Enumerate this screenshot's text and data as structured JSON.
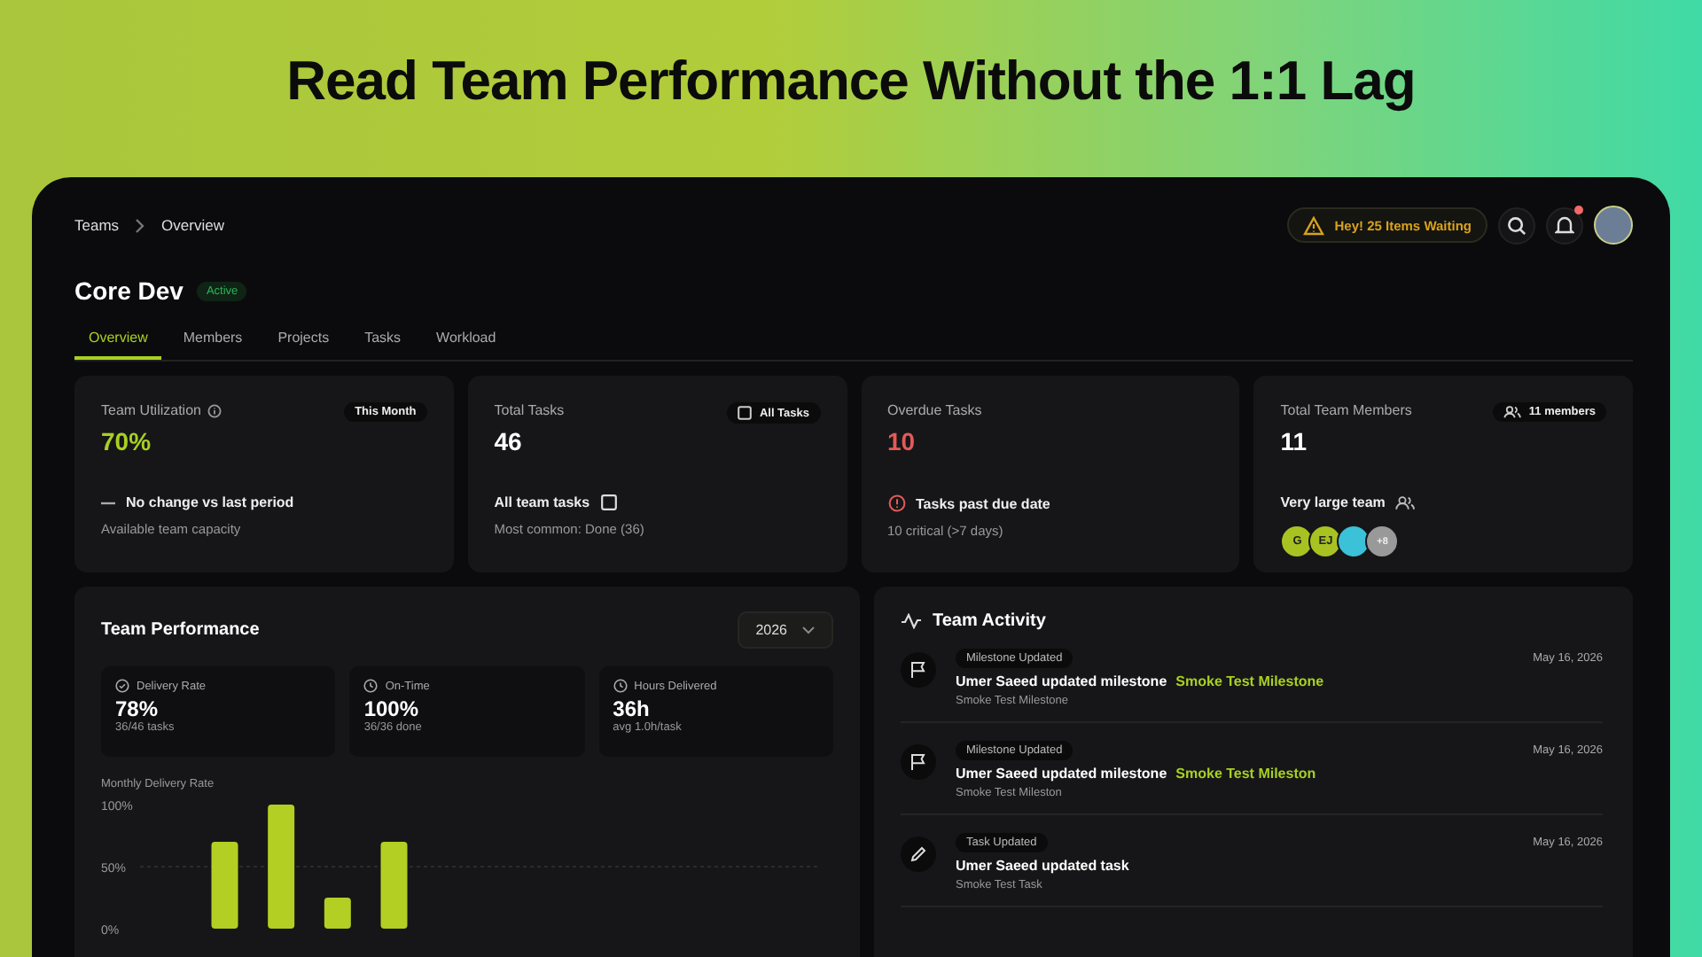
{
  "headline": "Read Team Performance Without the 1:1 Lag",
  "breadcrumb": [
    "Teams",
    "Overview"
  ],
  "alert": {
    "text": "Hey! 25 Items Waiting"
  },
  "notifications": {
    "unread": true
  },
  "team": {
    "name": "Core Dev",
    "status": "Active"
  },
  "tabs": [
    {
      "label": "Overview",
      "selected": true
    },
    {
      "label": "Members",
      "selected": false
    },
    {
      "label": "Projects",
      "selected": false
    },
    {
      "label": "Tasks",
      "selected": false
    },
    {
      "label": "Workload",
      "selected": false
    }
  ],
  "stats": [
    {
      "kind": "utilization",
      "label": "Team Utilization",
      "badge": "This Month",
      "value": "70%",
      "color": "#a8d022",
      "note": "No change vs last period",
      "sub": "Available team capacity"
    },
    {
      "kind": "tasks",
      "label": "Total Tasks",
      "badge": "All Tasks",
      "value": "46",
      "color": "#ffffff",
      "note": "All team tasks",
      "sub": "Most common: Done (36)"
    },
    {
      "kind": "overdue",
      "label": "Overdue Tasks",
      "value": "10",
      "color": "#e35a5a",
      "note": "Tasks past due date",
      "sub": "10 critical (>7 days)"
    },
    {
      "kind": "members",
      "label": "Total Team Members",
      "badge": "11 members",
      "value": "11",
      "color": "#ffffff",
      "note": "Very large team",
      "avatars": [
        {
          "kind": "initials",
          "text": "G"
        },
        {
          "kind": "initials",
          "text": "EJ"
        },
        {
          "kind": "photo"
        },
        {
          "kind": "count",
          "text": "+8"
        }
      ]
    }
  ],
  "performance": {
    "title": "Team Performance",
    "year": "2026",
    "metrics": [
      {
        "kind": "check",
        "label": "Delivery Rate",
        "value": "78%",
        "sub": "36/46 tasks"
      },
      {
        "kind": "clock",
        "label": "On-Time",
        "value": "100%",
        "sub": "36/36 done"
      },
      {
        "kind": "clock",
        "label": "Hours Delivered",
        "value": "36h",
        "sub": "avg 1.0h/task"
      }
    ],
    "chart_data": {
      "type": "bar",
      "title": "Monthly Delivery Rate",
      "values": [
        null,
        70,
        100,
        25,
        70,
        null,
        null,
        null,
        null,
        null,
        null,
        null
      ],
      "ylim": [
        0,
        100
      ],
      "yticks": [
        {
          "value": 0,
          "label": "0%"
        },
        {
          "value": 50,
          "label": "50%"
        },
        {
          "value": 100,
          "label": "100%"
        }
      ]
    }
  },
  "activity": {
    "title": "Team Activity",
    "items": [
      {
        "kind": "milestone",
        "tag": "Milestone Updated",
        "text": "Umer Saeed updated milestone",
        "link": "Smoke Test Milestone",
        "detail": "Smoke Test Milestone",
        "date": "May 16, 2026"
      },
      {
        "kind": "milestone",
        "tag": "Milestone Updated",
        "text": "Umer Saeed updated milestone",
        "link": "Smoke Test Mileston",
        "detail": "Smoke Test Mileston",
        "date": "May 16, 2026"
      },
      {
        "kind": "task",
        "tag": "Task Updated",
        "text": "Umer Saeed updated task",
        "detail": "Smoke Test Task",
        "date": "May 16, 2026"
      }
    ]
  }
}
